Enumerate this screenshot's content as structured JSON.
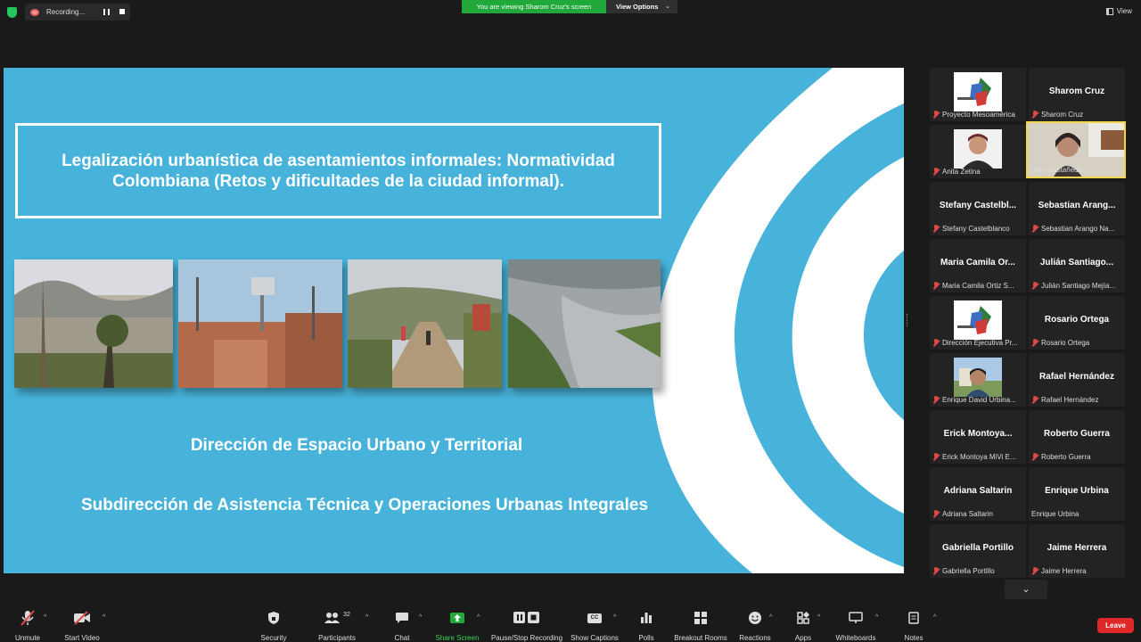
{
  "topbar": {
    "recording_label": "Recording...",
    "viewing_banner": "You are viewing Sharom Cruz's screen",
    "view_options": "View Options",
    "view_label": "View"
  },
  "slide": {
    "title": "Legalización urbanística de asentamientos informales: Normatividad Colombiana (Retos y dificultades de la ciudad informal).",
    "subtitle_1": "Dirección de Espacio Urbano y Territorial",
    "subtitle_2": "Subdirección de Asistencia Técnica y Operaciones Urbanas Integrales"
  },
  "participants": [
    {
      "name": "",
      "label": "Proyecto Mesoamérica",
      "muted": true,
      "video": "logo"
    },
    {
      "name": "Sharom Cruz",
      "label": "Sharom Cruz",
      "muted": true,
      "video": "none"
    },
    {
      "name": "",
      "label": "Anita Zetina",
      "muted": true,
      "video": "photo"
    },
    {
      "name": "",
      "label": "Clara Castañeda",
      "muted": false,
      "video": "camera",
      "active": true
    },
    {
      "name": "Stefany Castelbl...",
      "label": "Stefany Castelblanco",
      "muted": true,
      "video": "none"
    },
    {
      "name": "Sebastian Arang...",
      "label": "Sebastian Arango Na...",
      "muted": true,
      "video": "none"
    },
    {
      "name": "Maria Camila Or...",
      "label": "Maria Camila Ortiz S...",
      "muted": true,
      "video": "none"
    },
    {
      "name": "Julián Santiago...",
      "label": "Julián Santiago Mejía...",
      "muted": true,
      "video": "none"
    },
    {
      "name": "",
      "label": "Dirección Ejecutiva Pr...",
      "muted": true,
      "video": "logo"
    },
    {
      "name": "Rosario Ortega",
      "label": "Rosario Ortega",
      "muted": true,
      "video": "none"
    },
    {
      "name": "",
      "label": "Enrique David Urbina...",
      "muted": true,
      "video": "photo2"
    },
    {
      "name": "Rafael Hernández",
      "label": "Rafael Hernández",
      "muted": true,
      "video": "none"
    },
    {
      "name": "Erick Montoya...",
      "label": "Erick Montoya MiVi E...",
      "muted": true,
      "video": "none"
    },
    {
      "name": "Roberto Guerra",
      "label": "Roberto Guerra",
      "muted": true,
      "video": "none"
    },
    {
      "name": "Adriana Saltarin",
      "label": "Adriana Saltarin",
      "muted": true,
      "video": "none"
    },
    {
      "name": "Enrique Urbina",
      "label": "Enrique Urbina",
      "muted": false,
      "video": "none"
    },
    {
      "name": "Gabriella Portillo",
      "label": "Gabriella Portillo",
      "muted": true,
      "video": "none"
    },
    {
      "name": "Jaime Herrera",
      "label": "Jaime Herrera",
      "muted": true,
      "video": "none"
    }
  ],
  "toolbar": {
    "unmute": "Unmute",
    "start_video": "Start Video",
    "security": "Security",
    "participants": "Participants",
    "participants_count": "32",
    "chat": "Chat",
    "share_screen": "Share Screen",
    "pause_recording": "Pause/Stop Recording",
    "show_captions": "Show Captions",
    "captions_icon_text": "CC",
    "polls": "Polls",
    "breakout_rooms": "Breakout Rooms",
    "reactions": "Reactions",
    "apps": "Apps",
    "whiteboards": "Whiteboards",
    "notes": "Notes",
    "leave": "Leave"
  },
  "colors": {
    "slide_bg": "#47b3da",
    "share_green": "#21a83b",
    "leave_red": "#e02828",
    "active_speaker": "#f0d64b"
  }
}
